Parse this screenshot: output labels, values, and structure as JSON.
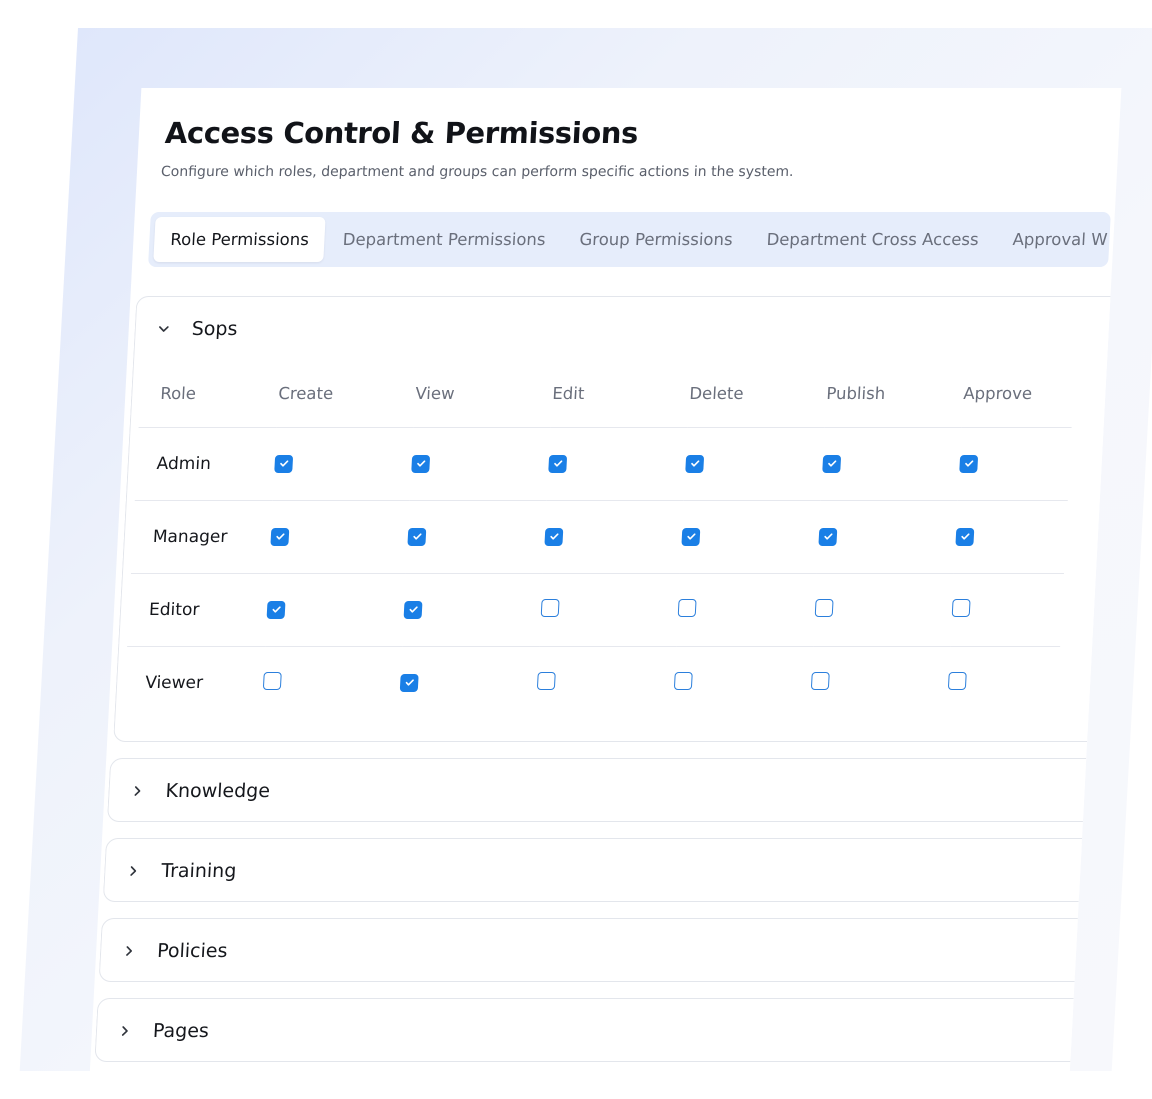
{
  "page": {
    "title": "Access Control & Permissions",
    "subtitle": "Configure which roles, department and groups can perform specific actions in the system."
  },
  "tabs": [
    {
      "label": "Role Permissions",
      "active": true
    },
    {
      "label": "Department Permissions",
      "active": false
    },
    {
      "label": "Group Permissions",
      "active": false
    },
    {
      "label": "Department Cross Access",
      "active": false
    },
    {
      "label": "Approval W",
      "active": false
    }
  ],
  "sections": [
    {
      "title": "Sops",
      "expanded": true,
      "columns": [
        "Role",
        "Create",
        "View",
        "Edit",
        "Delete",
        "Publish",
        "Approve"
      ],
      "rows": [
        {
          "role": "Admin",
          "perms": [
            true,
            true,
            true,
            true,
            true,
            true
          ]
        },
        {
          "role": "Manager",
          "perms": [
            true,
            true,
            true,
            true,
            true,
            true
          ]
        },
        {
          "role": "Editor",
          "perms": [
            true,
            true,
            false,
            false,
            false,
            false
          ]
        },
        {
          "role": "Viewer",
          "perms": [
            false,
            true,
            false,
            false,
            false,
            false
          ]
        }
      ]
    },
    {
      "title": "Knowledge",
      "expanded": false
    },
    {
      "title": "Training",
      "expanded": false
    },
    {
      "title": "Policies",
      "expanded": false
    },
    {
      "title": "Pages",
      "expanded": false
    }
  ],
  "colors": {
    "accent": "#1a7fe6",
    "tab_bar": "#e6edfb",
    "border": "#e3e6ec"
  },
  "icons": {
    "expanded": "chevron-down-icon",
    "collapsed": "chevron-right-icon",
    "checked": "check-icon"
  }
}
